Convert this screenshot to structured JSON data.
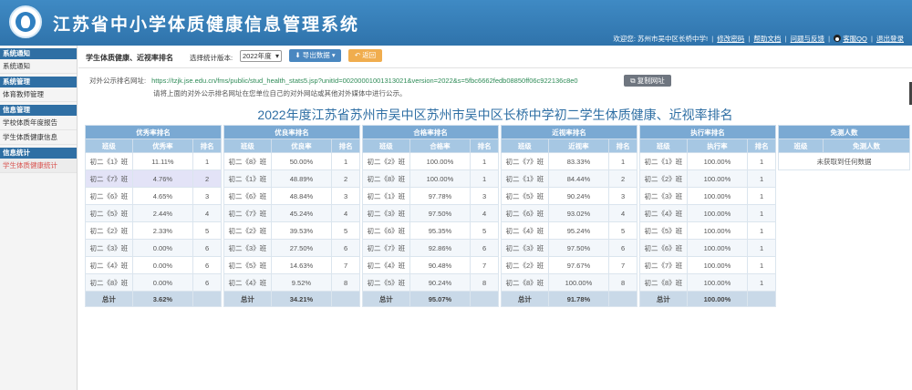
{
  "app": {
    "title": "江苏省中小学体质健康信息管理系统",
    "user_welcome": "欢迎您: 苏州市吴中区长桥中学!",
    "links": [
      "修改密码",
      "帮助文档",
      "问题与反馈"
    ],
    "qq_label": "客服QQ",
    "logout": "退出登录"
  },
  "sidebar": [
    {
      "head": "系统通知",
      "items": [
        {
          "label": "系统通知",
          "active": false
        }
      ]
    },
    {
      "head": "系统管理",
      "items": [
        {
          "label": "体育教师管理",
          "active": false
        }
      ]
    },
    {
      "head": "信息管理",
      "items": [
        {
          "label": "学校体质年度报告",
          "active": false
        },
        {
          "label": "学生体质健康信息",
          "active": false
        }
      ]
    },
    {
      "head": "信息统计",
      "items": [
        {
          "label": "学生体质健康统计",
          "active": true
        }
      ]
    }
  ],
  "toolbar": {
    "page_label": "学生体质健康、近视率排名",
    "version_label": "选择统计版本:",
    "version_value": "2022年度",
    "export_label": "导出数据",
    "back_label": "返回"
  },
  "url_section": {
    "label": "对外公示排名网址:",
    "url": "https://tzjk.jse.edu.cn/fms/public/stud_health_stats5.jsp?unitId=00200001001313021&version=2022&s=5fbc6662fedb08850ff06c922136c8e0",
    "copy_label": "复制网址",
    "note": "请将上面的对外公示排名网址在您单位自己的对外网站或其他对外媒体中进行公示。"
  },
  "report_title": "2022年度江苏省苏州市吴中区苏州市吴中区长桥中学初二学生体质健康、近视率排名",
  "tables": [
    {
      "caption": "优秀率排名",
      "cols": [
        "班级",
        "优秀率",
        "排名"
      ],
      "rows": [
        [
          "初二《1》班",
          "11.11%",
          "1"
        ],
        [
          "初二《7》班",
          "4.76%",
          "2"
        ],
        [
          "初二《6》班",
          "4.65%",
          "3"
        ],
        [
          "初二《5》班",
          "2.44%",
          "4"
        ],
        [
          "初二《2》班",
          "2.33%",
          "5"
        ],
        [
          "初二《3》班",
          "0.00%",
          "6"
        ],
        [
          "初二《4》班",
          "0.00%",
          "6"
        ],
        [
          "初二《8》班",
          "0.00%",
          "6"
        ]
      ],
      "total": [
        "总计",
        "3.62%"
      ],
      "highlight_row": 1
    },
    {
      "caption": "优良率排名",
      "cols": [
        "班级",
        "优良率",
        "排名"
      ],
      "rows": [
        [
          "初二《8》班",
          "50.00%",
          "1"
        ],
        [
          "初二《1》班",
          "48.89%",
          "2"
        ],
        [
          "初二《6》班",
          "48.84%",
          "3"
        ],
        [
          "初二《7》班",
          "45.24%",
          "4"
        ],
        [
          "初二《2》班",
          "39.53%",
          "5"
        ],
        [
          "初二《3》班",
          "27.50%",
          "6"
        ],
        [
          "初二《5》班",
          "14.63%",
          "7"
        ],
        [
          "初二《4》班",
          "9.52%",
          "8"
        ]
      ],
      "total": [
        "总计",
        "34.21%"
      ],
      "highlight_row": -1
    },
    {
      "caption": "合格率排名",
      "cols": [
        "班级",
        "合格率",
        "排名"
      ],
      "rows": [
        [
          "初二《2》班",
          "100.00%",
          "1"
        ],
        [
          "初二《8》班",
          "100.00%",
          "1"
        ],
        [
          "初二《1》班",
          "97.78%",
          "3"
        ],
        [
          "初二《3》班",
          "97.50%",
          "4"
        ],
        [
          "初二《6》班",
          "95.35%",
          "5"
        ],
        [
          "初二《7》班",
          "92.86%",
          "6"
        ],
        [
          "初二《4》班",
          "90.48%",
          "7"
        ],
        [
          "初二《5》班",
          "90.24%",
          "8"
        ]
      ],
      "total": [
        "总计",
        "95.07%"
      ],
      "highlight_row": -1
    },
    {
      "caption": "近视率排名",
      "cols": [
        "班级",
        "近视率",
        "排名"
      ],
      "rows": [
        [
          "初二《7》班",
          "83.33%",
          "1"
        ],
        [
          "初二《1》班",
          "84.44%",
          "2"
        ],
        [
          "初二《5》班",
          "90.24%",
          "3"
        ],
        [
          "初二《6》班",
          "93.02%",
          "4"
        ],
        [
          "初二《4》班",
          "95.24%",
          "5"
        ],
        [
          "初二《3》班",
          "97.50%",
          "6"
        ],
        [
          "初二《2》班",
          "97.67%",
          "7"
        ],
        [
          "初二《8》班",
          "100.00%",
          "8"
        ]
      ],
      "total": [
        "总计",
        "91.78%"
      ],
      "highlight_row": -1
    },
    {
      "caption": "执行率排名",
      "cols": [
        "班级",
        "执行率",
        "排名"
      ],
      "rows": [
        [
          "初二《1》班",
          "100.00%",
          "1"
        ],
        [
          "初二《2》班",
          "100.00%",
          "1"
        ],
        [
          "初二《3》班",
          "100.00%",
          "1"
        ],
        [
          "初二《4》班",
          "100.00%",
          "1"
        ],
        [
          "初二《5》班",
          "100.00%",
          "1"
        ],
        [
          "初二《6》班",
          "100.00%",
          "1"
        ],
        [
          "初二《7》班",
          "100.00%",
          "1"
        ],
        [
          "初二《8》班",
          "100.00%",
          "1"
        ]
      ],
      "total": [
        "总计",
        "100.00%"
      ],
      "highlight_row": -1
    }
  ],
  "exempt_table": {
    "caption": "免测人数",
    "cols": [
      "班级",
      "免测人数"
    ],
    "empty_message": "未获取到任何数据"
  }
}
